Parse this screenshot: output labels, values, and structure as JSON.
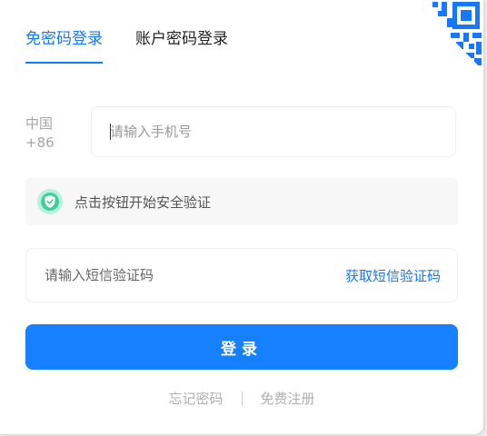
{
  "tabs": [
    {
      "label": "免密码登录",
      "active": true
    },
    {
      "label": "账户密码登录",
      "active": false
    }
  ],
  "country": {
    "name": "中国",
    "code": "+86"
  },
  "phone": {
    "placeholder": "请输入手机号",
    "value": ""
  },
  "verify": {
    "text": "点击按钮开始安全验证",
    "icon": "shield-check-icon"
  },
  "sms": {
    "placeholder": "请输入短信验证码",
    "value": "",
    "get_code_label": "获取短信验证码"
  },
  "login_button": {
    "label": "登录"
  },
  "footer": {
    "forgot_password": "忘记密码",
    "register": "免费注册"
  },
  "corner": {
    "icon": "qr-code-icon"
  },
  "colors": {
    "accent": "#1677ff",
    "button": "#1680ff",
    "shield": "#3ecf9b"
  }
}
